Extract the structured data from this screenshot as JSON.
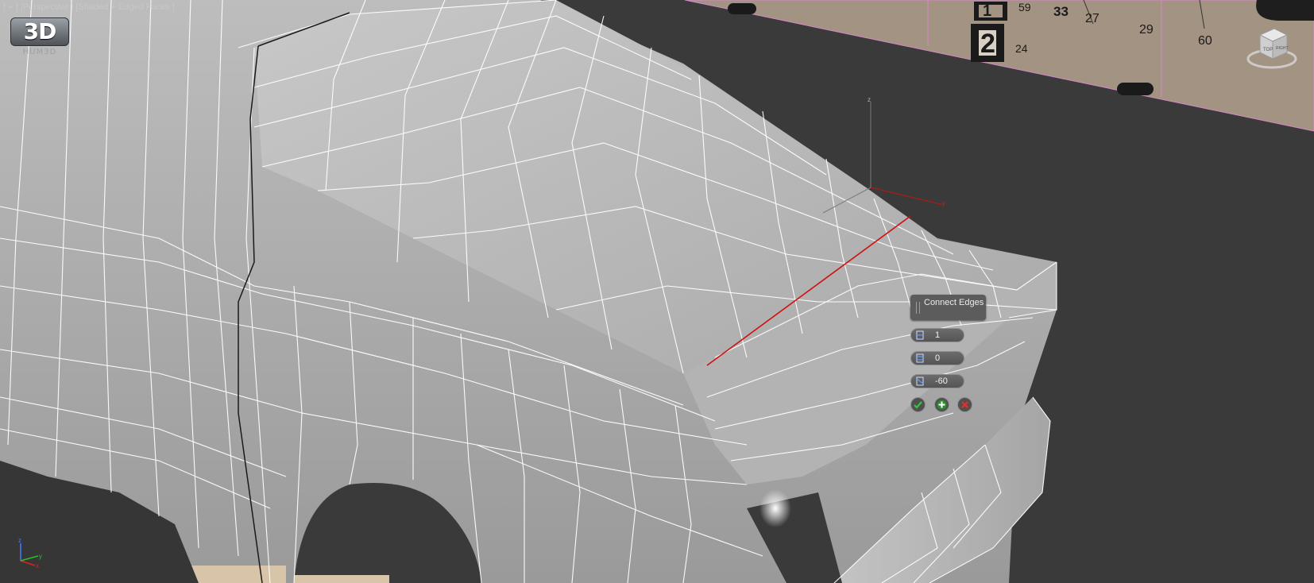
{
  "viewport": {
    "label": "[ + ] [Perspective ] [Shaded + Edged Faces ]",
    "logo": {
      "badge": "3D",
      "text": "HUM3D"
    },
    "poster_numbers": [
      "59",
      "33",
      "27",
      "29",
      "60",
      "24"
    ],
    "poster_big_numbers": [
      "1",
      "2"
    ],
    "gizmo": {
      "labels": [
        "z",
        "x",
        "y"
      ]
    },
    "tripod": {
      "labels": [
        "z",
        "x",
        "y"
      ]
    },
    "viewcube": {
      "labels": [
        "TOP",
        "RIGHT"
      ]
    }
  },
  "caddy": {
    "title": "Connect Edges",
    "fields": [
      {
        "name": "segments",
        "value": "1",
        "icon": "segments-icon"
      },
      {
        "name": "pinch",
        "value": "0",
        "icon": "pinch-icon"
      },
      {
        "name": "slide",
        "value": "-60",
        "icon": "slide-icon"
      }
    ],
    "buttons": [
      {
        "name": "ok",
        "icon": "check-icon"
      },
      {
        "name": "apply",
        "icon": "plus-icon"
      },
      {
        "name": "cancel",
        "icon": "close-icon"
      }
    ]
  },
  "colors": {
    "background": "#3a3a3a",
    "mesh_face": "#b9b9b9",
    "wire": "#ffffff",
    "selected_edge": "#d01010",
    "poster": "#9c8c7c",
    "ok_green": "#2e8b2e",
    "cancel_red": "#c02020"
  }
}
